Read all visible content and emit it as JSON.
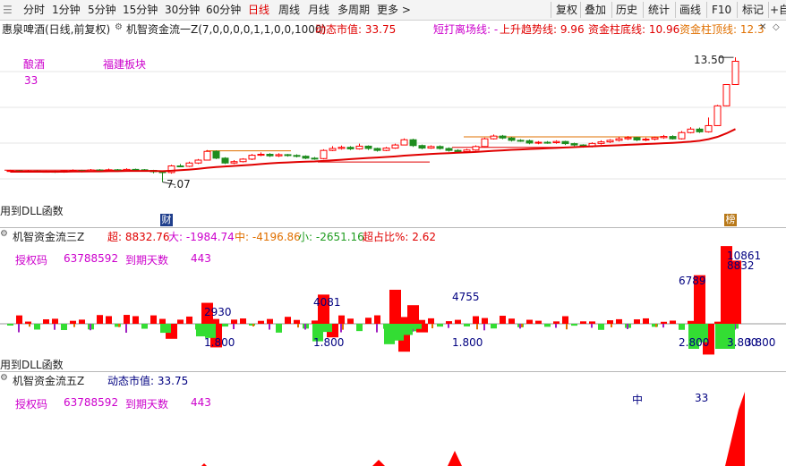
{
  "toolbar": {
    "periods": [
      "分时",
      "1分钟",
      "5分钟",
      "15分钟",
      "30分钟",
      "60分钟",
      "日线",
      "周线",
      "月线",
      "多周期",
      "更多 >"
    ],
    "active_period": "日线",
    "right_buttons": [
      "复权",
      "叠加",
      "历史",
      "统计",
      "画线",
      "F10",
      "标记",
      "+自"
    ]
  },
  "header": {
    "stock_label": "惠泉啤酒(日线,前复权)",
    "indicator_title": "机智资金流一Z(7,0,0,0,0,1,1,0,0,1000)",
    "market_cap": "动态市值: 33.75",
    "short_line": "短打离场线: -",
    "uptrend": "上升趋势线: 9.96",
    "fund_bottom": "资金柱底线: 10.96",
    "fund_top": "资金柱顶线: 12.3"
  },
  "main_panel": {
    "sector_label": "酿酒",
    "sector_value": "33",
    "board_label": "福建板块",
    "high_price": "13.50",
    "low_price": "7.07",
    "dll_note": "用到DLL函数",
    "badge_cai": "财",
    "badge_bang": "榜"
  },
  "panel2": {
    "title": "机智资金流三Z",
    "super_label": "超: 8832.76",
    "big_label": "大: -1984.74",
    "mid_label": "中: -4196.86",
    "small_label": "小: -2651.16",
    "ratio_label": "超占比%: 2.62",
    "auth_code_label": "授权码",
    "auth_code_value": "63788592",
    "expire_label": "到期天数",
    "expire_value": "443",
    "bar_labels": [
      "2930",
      "1.800",
      "4081",
      "1.800",
      "4755",
      "1.800",
      "6789",
      "2.800",
      "10861",
      "8832",
      "3.800",
      "3.800"
    ],
    "dll_note": "用到DLL函数"
  },
  "panel3": {
    "title": "机智资金流五Z",
    "market_cap": "动态市值: 33.75",
    "auth_code_label": "授权码",
    "auth_code_value": "63788592",
    "expire_label": "到期天数",
    "expire_value": "443",
    "mid_label": "中",
    "mid_value": "33"
  },
  "colors": {
    "up": "#ff0000",
    "down": "#1e8c1e",
    "ma": "#e00000",
    "green_bar": "#33dd33",
    "purple": "#a020c0",
    "orange": "#e07000",
    "blue": "#000080",
    "magenta": "#cc00cc"
  },
  "candles": [
    {
      "o": 7.62,
      "c": 7.66,
      "h": 7.7,
      "l": 7.58
    },
    {
      "o": 7.64,
      "c": 7.6,
      "h": 7.68,
      "l": 7.56
    },
    {
      "o": 7.6,
      "c": 7.63,
      "h": 7.67,
      "l": 7.57
    },
    {
      "o": 7.63,
      "c": 7.61,
      "h": 7.66,
      "l": 7.58
    },
    {
      "o": 7.61,
      "c": 7.62,
      "h": 7.65,
      "l": 7.57
    },
    {
      "o": 7.62,
      "c": 7.58,
      "h": 7.65,
      "l": 7.54
    },
    {
      "o": 7.58,
      "c": 7.64,
      "h": 7.68,
      "l": 7.55
    },
    {
      "o": 7.64,
      "c": 7.66,
      "h": 7.72,
      "l": 7.6
    },
    {
      "o": 7.66,
      "c": 7.6,
      "h": 7.7,
      "l": 7.57
    },
    {
      "o": 7.6,
      "c": 7.69,
      "h": 7.74,
      "l": 7.58
    },
    {
      "o": 7.69,
      "c": 7.67,
      "h": 7.73,
      "l": 7.63
    },
    {
      "o": 7.67,
      "c": 7.7,
      "h": 7.76,
      "l": 7.62
    },
    {
      "o": 7.7,
      "c": 7.66,
      "h": 7.74,
      "l": 7.62
    },
    {
      "o": 7.66,
      "c": 7.72,
      "h": 7.78,
      "l": 7.63
    },
    {
      "o": 7.72,
      "c": 7.7,
      "h": 7.76,
      "l": 7.66
    },
    {
      "o": 7.7,
      "c": 7.67,
      "h": 7.74,
      "l": 7.63
    },
    {
      "o": 7.67,
      "c": 7.6,
      "h": 7.7,
      "l": 7.52
    },
    {
      "o": 7.6,
      "c": 7.56,
      "h": 7.64,
      "l": 7.07
    },
    {
      "o": 7.56,
      "c": 7.9,
      "h": 7.96,
      "l": 7.5
    },
    {
      "o": 7.9,
      "c": 7.88,
      "h": 8.0,
      "l": 7.84
    },
    {
      "o": 7.88,
      "c": 8.05,
      "h": 8.12,
      "l": 7.84
    },
    {
      "o": 8.05,
      "c": 8.2,
      "h": 8.26,
      "l": 8.0
    },
    {
      "o": 8.2,
      "c": 8.65,
      "h": 8.72,
      "l": 8.18
    },
    {
      "o": 8.65,
      "c": 8.3,
      "h": 8.7,
      "l": 8.25
    },
    {
      "o": 8.3,
      "c": 8.05,
      "h": 8.35,
      "l": 8.0
    },
    {
      "o": 8.05,
      "c": 8.12,
      "h": 8.2,
      "l": 8.0
    },
    {
      "o": 8.12,
      "c": 8.25,
      "h": 8.3,
      "l": 8.08
    },
    {
      "o": 8.25,
      "c": 8.45,
      "h": 8.52,
      "l": 8.2
    },
    {
      "o": 8.45,
      "c": 8.5,
      "h": 8.6,
      "l": 8.4
    },
    {
      "o": 8.5,
      "c": 8.42,
      "h": 8.56,
      "l": 8.36
    },
    {
      "o": 8.42,
      "c": 8.48,
      "h": 8.55,
      "l": 8.36
    },
    {
      "o": 8.48,
      "c": 8.44,
      "h": 8.52,
      "l": 8.38
    },
    {
      "o": 8.44,
      "c": 8.4,
      "h": 8.5,
      "l": 8.34
    },
    {
      "o": 8.4,
      "c": 8.3,
      "h": 8.45,
      "l": 8.25
    },
    {
      "o": 8.3,
      "c": 8.28,
      "h": 8.36,
      "l": 8.22
    },
    {
      "o": 8.28,
      "c": 8.7,
      "h": 8.76,
      "l": 8.24
    },
    {
      "o": 8.7,
      "c": 8.8,
      "h": 8.92,
      "l": 8.66
    },
    {
      "o": 8.8,
      "c": 8.86,
      "h": 8.95,
      "l": 8.74
    },
    {
      "o": 8.86,
      "c": 8.78,
      "h": 8.92,
      "l": 8.72
    },
    {
      "o": 8.78,
      "c": 8.92,
      "h": 9.05,
      "l": 8.74
    },
    {
      "o": 8.92,
      "c": 8.8,
      "h": 8.96,
      "l": 8.72
    },
    {
      "o": 8.8,
      "c": 8.7,
      "h": 8.84,
      "l": 8.64
    },
    {
      "o": 8.7,
      "c": 8.82,
      "h": 8.88,
      "l": 8.66
    },
    {
      "o": 8.82,
      "c": 8.98,
      "h": 9.05,
      "l": 8.78
    },
    {
      "o": 8.98,
      "c": 9.25,
      "h": 9.32,
      "l": 8.96
    },
    {
      "o": 9.25,
      "c": 8.95,
      "h": 9.3,
      "l": 8.88
    },
    {
      "o": 8.95,
      "c": 8.82,
      "h": 9.0,
      "l": 8.76
    },
    {
      "o": 8.82,
      "c": 8.9,
      "h": 8.96,
      "l": 8.78
    },
    {
      "o": 8.9,
      "c": 8.8,
      "h": 8.96,
      "l": 8.74
    },
    {
      "o": 8.8,
      "c": 8.7,
      "h": 8.86,
      "l": 8.64
    },
    {
      "o": 8.7,
      "c": 8.64,
      "h": 8.76,
      "l": 8.58
    },
    {
      "o": 8.64,
      "c": 8.72,
      "h": 8.78,
      "l": 8.58
    },
    {
      "o": 8.72,
      "c": 8.9,
      "h": 8.96,
      "l": 8.68
    },
    {
      "o": 8.9,
      "c": 9.3,
      "h": 9.36,
      "l": 8.86
    },
    {
      "o": 9.3,
      "c": 9.44,
      "h": 9.52,
      "l": 9.26
    },
    {
      "o": 9.44,
      "c": 9.34,
      "h": 9.5,
      "l": 9.28
    },
    {
      "o": 9.34,
      "c": 9.22,
      "h": 9.4,
      "l": 9.16
    },
    {
      "o": 9.22,
      "c": 9.2,
      "h": 9.28,
      "l": 9.14
    },
    {
      "o": 9.2,
      "c": 9.08,
      "h": 9.26,
      "l": 9.02
    },
    {
      "o": 9.08,
      "c": 9.12,
      "h": 9.18,
      "l": 9.02
    },
    {
      "o": 9.12,
      "c": 9.1,
      "h": 9.18,
      "l": 9.04
    },
    {
      "o": 9.1,
      "c": 9.16,
      "h": 9.22,
      "l": 9.04
    },
    {
      "o": 9.16,
      "c": 9.05,
      "h": 9.2,
      "l": 8.98
    },
    {
      "o": 9.05,
      "c": 8.98,
      "h": 9.1,
      "l": 8.92
    },
    {
      "o": 8.98,
      "c": 8.9,
      "h": 9.02,
      "l": 8.84
    },
    {
      "o": 8.9,
      "c": 9.06,
      "h": 9.12,
      "l": 8.86
    },
    {
      "o": 9.06,
      "c": 9.14,
      "h": 9.22,
      "l": 9.0
    },
    {
      "o": 9.14,
      "c": 9.22,
      "h": 9.28,
      "l": 9.08
    },
    {
      "o": 9.22,
      "c": 9.3,
      "h": 9.4,
      "l": 9.16
    },
    {
      "o": 9.3,
      "c": 9.36,
      "h": 9.44,
      "l": 9.24
    },
    {
      "o": 9.36,
      "c": 9.24,
      "h": 9.4,
      "l": 9.18
    },
    {
      "o": 9.24,
      "c": 9.28,
      "h": 9.36,
      "l": 9.18
    },
    {
      "o": 9.28,
      "c": 9.36,
      "h": 9.42,
      "l": 9.22
    },
    {
      "o": 9.36,
      "c": 9.42,
      "h": 9.5,
      "l": 9.3
    },
    {
      "o": 9.42,
      "c": 9.3,
      "h": 9.48,
      "l": 9.26
    },
    {
      "o": 9.3,
      "c": 9.62,
      "h": 9.7,
      "l": 9.26
    },
    {
      "o": 9.62,
      "c": 9.8,
      "h": 9.9,
      "l": 9.58
    },
    {
      "o": 9.8,
      "c": 9.66,
      "h": 9.88,
      "l": 9.6
    },
    {
      "o": 9.66,
      "c": 9.98,
      "h": 10.4,
      "l": 9.62
    },
    {
      "o": 9.98,
      "c": 11.0,
      "h": 11.05,
      "l": 9.96
    },
    {
      "o": 11.0,
      "c": 12.1,
      "h": 12.1,
      "l": 10.98
    },
    {
      "o": 12.1,
      "c": 13.3,
      "h": 13.5,
      "l": 12.1
    }
  ],
  "ma": [
    7.6,
    7.6,
    7.6,
    7.6,
    7.6,
    7.6,
    7.6,
    7.61,
    7.61,
    7.62,
    7.62,
    7.63,
    7.63,
    7.64,
    7.64,
    7.64,
    7.64,
    7.63,
    7.65,
    7.68,
    7.71,
    7.75,
    7.8,
    7.84,
    7.87,
    7.9,
    7.93,
    7.96,
    8.0,
    8.03,
    8.06,
    8.08,
    8.1,
    8.12,
    8.13,
    8.16,
    8.19,
    8.22,
    8.25,
    8.28,
    8.31,
    8.33,
    8.36,
    8.39,
    8.43,
    8.46,
    8.49,
    8.52,
    8.54,
    8.56,
    8.58,
    8.6,
    8.62,
    8.65,
    8.68,
    8.7,
    8.73,
    8.75,
    8.77,
    8.79,
    8.81,
    8.83,
    8.85,
    8.87,
    8.89,
    8.91,
    8.93,
    8.95,
    8.97,
    8.99,
    9.01,
    9.03,
    9.05,
    9.07,
    9.09,
    9.12,
    9.15,
    9.2,
    9.28,
    9.4,
    9.58,
    9.8
  ],
  "fund_bars": [
    {
      "i": 18,
      "v": -2100
    },
    {
      "i": 22,
      "v": 2930
    },
    {
      "i": 23,
      "v": -3300
    },
    {
      "i": 35,
      "v": 4081
    },
    {
      "i": 36,
      "v": -1900
    },
    {
      "i": 43,
      "v": 4755
    },
    {
      "i": 44,
      "v": -3900
    },
    {
      "i": 45,
      "v": 2600
    },
    {
      "i": 46,
      "v": -1200
    },
    {
      "i": 77,
      "v": 6789
    },
    {
      "i": 78,
      "v": -4300
    },
    {
      "i": 80,
      "v": 10861
    },
    {
      "i": 81,
      "v": 8832
    }
  ]
}
